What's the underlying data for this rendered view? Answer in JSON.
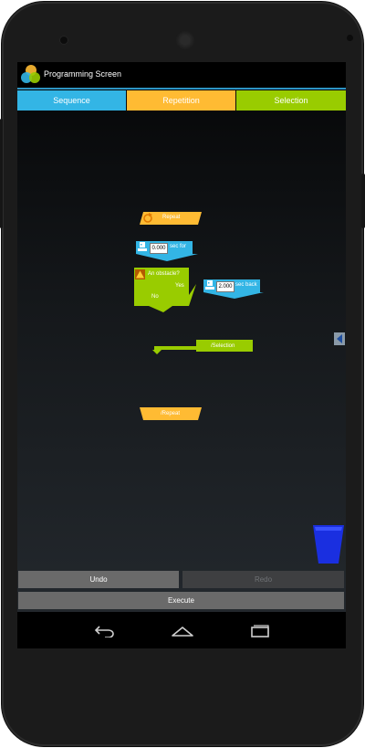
{
  "app": {
    "title": "Programming Screen"
  },
  "tabs": [
    {
      "label": "Sequence",
      "color": "#33b5e5"
    },
    {
      "label": "Repetition",
      "color": "#ffbb33"
    },
    {
      "label": "Selection",
      "color": "#99cc00"
    }
  ],
  "blocks": {
    "repeat_start": "Repeat",
    "move_forward": {
      "value": "0.000",
      "label": "sec for"
    },
    "selection": {
      "condition": "An obstacle?",
      "yes": "Yes",
      "no": "No"
    },
    "move_back": {
      "value": "2.000",
      "label": "sec back"
    },
    "selection_end": "/Selection",
    "repeat_end": "/Repeat"
  },
  "buttons": {
    "undo": "Undo",
    "redo": "Redo",
    "execute": "Execute"
  },
  "colors": {
    "sequence": "#33b5e5",
    "repetition": "#ffbb33",
    "selection": "#99cc00",
    "trash": "#1a2fe0"
  },
  "icons": [
    "robot-icon",
    "warning-icon",
    "drawer-arrow-icon",
    "trash-icon",
    "back-icon",
    "home-icon",
    "recents-icon"
  ]
}
